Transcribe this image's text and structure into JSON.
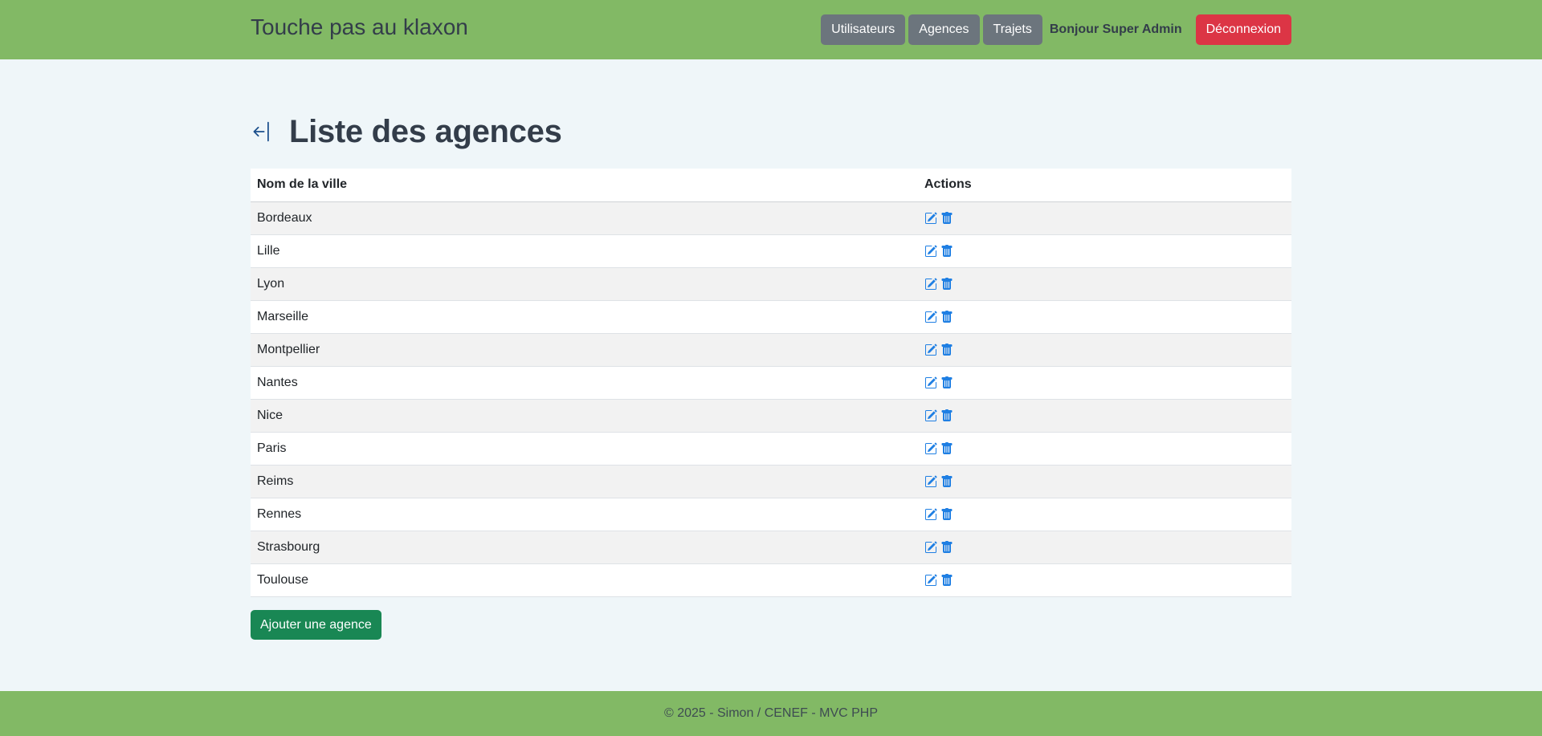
{
  "header": {
    "brand": "Touche pas au klaxon",
    "nav": [
      "Utilisateurs",
      "Agences",
      "Trajets"
    ],
    "greeting": "Bonjour Super Admin",
    "logout": "Déconnexion"
  },
  "page": {
    "title": "Liste des agences",
    "back_icon": "arrow-bar-left-icon"
  },
  "table": {
    "headers": [
      "Nom de la ville",
      "Actions"
    ],
    "rows": [
      "Bordeaux",
      "Lille",
      "Lyon",
      "Marseille",
      "Montpellier",
      "Nantes",
      "Nice",
      "Paris",
      "Reims",
      "Rennes",
      "Strasbourg",
      "Toulouse"
    ],
    "row_icons": [
      "edit-icon",
      "trash-icon"
    ]
  },
  "add_button": "Ajouter une agence",
  "footer": "© 2025 - Simon / CENEF - MVC PHP",
  "colors": {
    "header_bg": "#82b965",
    "page_bg": "#eff6f9",
    "nav_button": "#6c757d",
    "logout_button": "#dc3545",
    "add_button": "#198754",
    "icon": "#0d6efd"
  }
}
